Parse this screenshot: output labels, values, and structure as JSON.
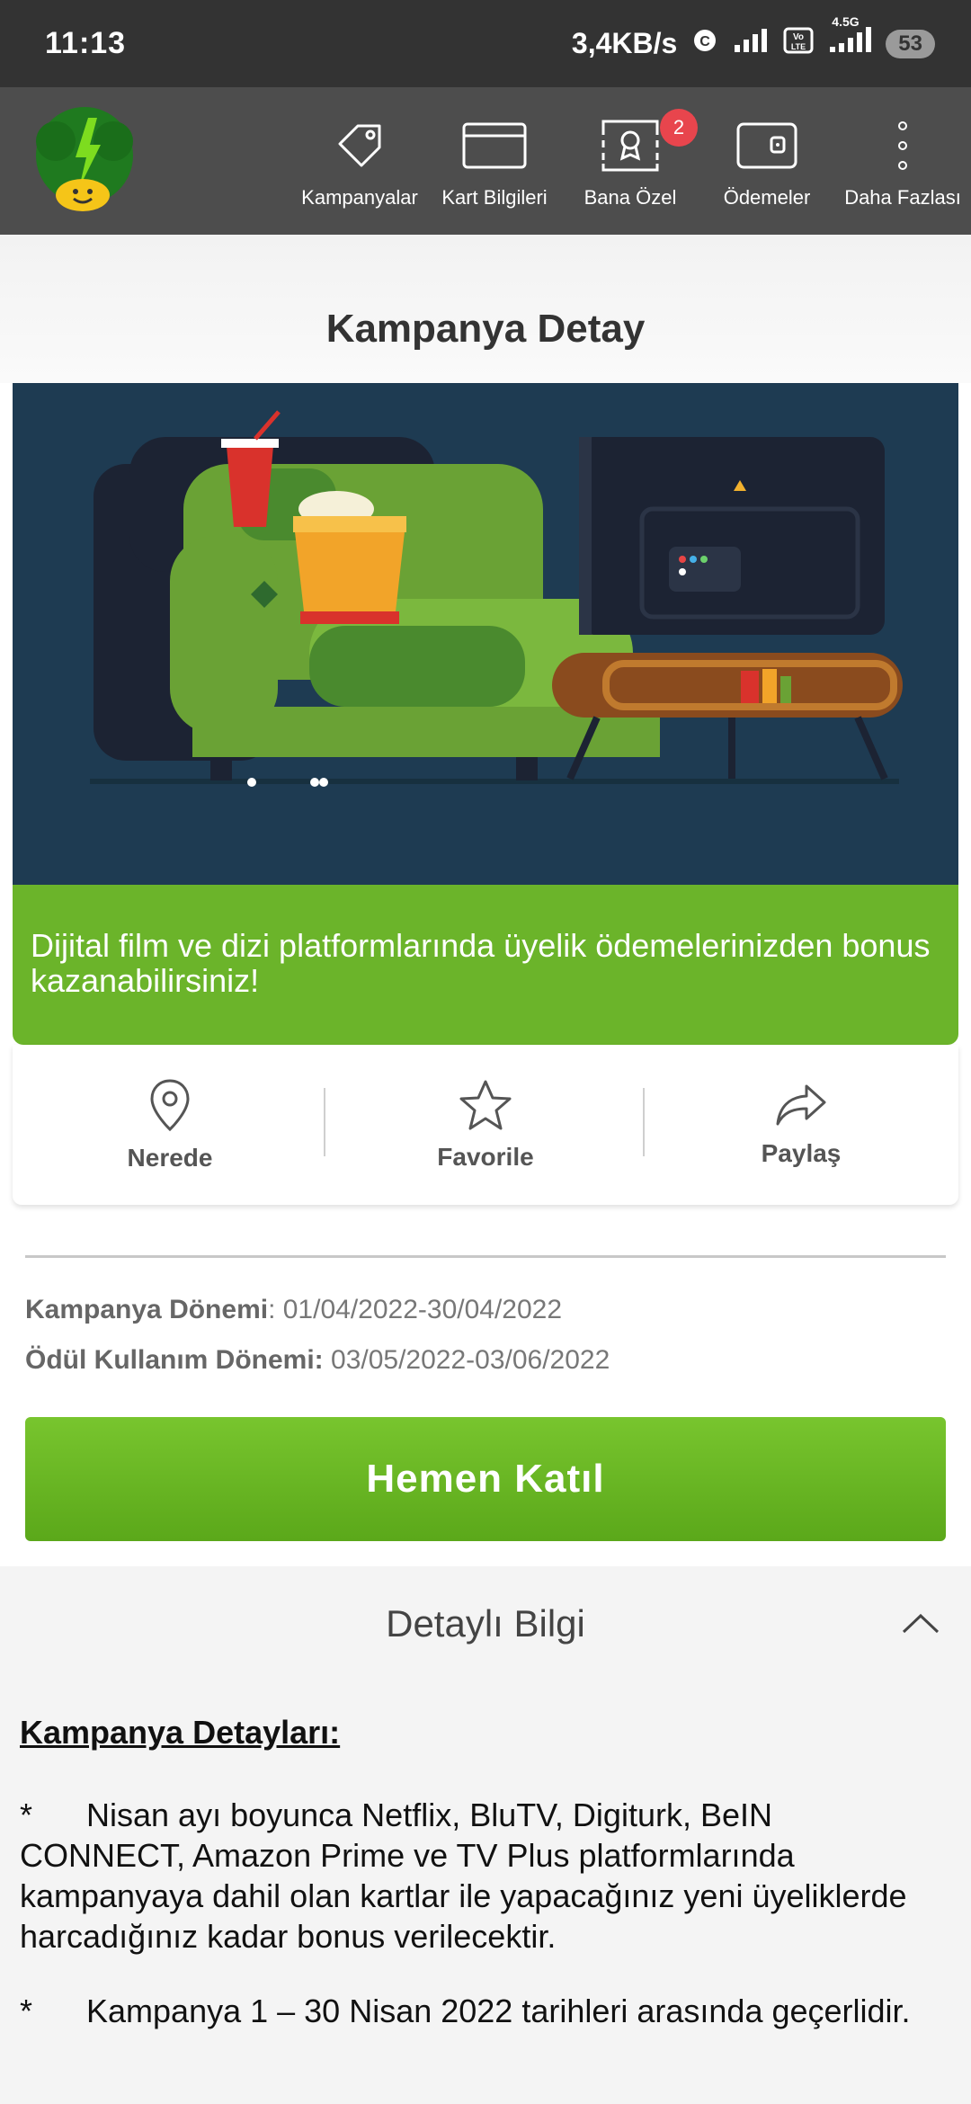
{
  "status_bar": {
    "time": "11:13",
    "speed": "3,4KB/s",
    "network_label": "4.5G",
    "volte_label": "Vo LTE",
    "battery": "53"
  },
  "nav": {
    "items": [
      {
        "label": "Kampanyalar",
        "icon": "tag-icon"
      },
      {
        "label": "Kart Bilgileri",
        "icon": "card-icon"
      },
      {
        "label": "Bana Özel",
        "icon": "award-icon",
        "badge": "2"
      },
      {
        "label": "Ödemeler",
        "icon": "wallet-icon"
      },
      {
        "label": "Daha Fazlası",
        "icon": "more-vertical-icon"
      }
    ]
  },
  "page": {
    "title": "Kampanya Detay"
  },
  "banner": {
    "caption": "Dijital film ve dizi platformlarında üyelik ödemelerinizden bonus kazanabilirsiniz!"
  },
  "actions": [
    {
      "label": "Nerede",
      "icon": "location-pin-icon"
    },
    {
      "label": "Favorile",
      "icon": "star-icon"
    },
    {
      "label": "Paylaş",
      "icon": "share-icon"
    }
  ],
  "periods": {
    "campaign_label": "Kampanya Dönemi",
    "campaign_value": ": 01/04/2022-30/04/2022",
    "reward_label": "Ödül Kullanım Dönemi:",
    "reward_value": " 03/05/2022-03/06/2022"
  },
  "cta": {
    "label": "Hemen Katıl"
  },
  "details": {
    "title": "Detaylı Bilgi",
    "heading": "Kampanya Detayları:",
    "bullets": [
      "Nisan ayı boyunca Netflix, BluTV, Digiturk, BeIN CONNECT, Amazon Prime ve TV Plus platformlarında kampanyaya dahil olan kartlar ile yapacağınız yeni üyeliklerde harcadığınız kadar bonus verilecektir.",
      "Kampanya 1 – 30 Nisan 2022 tarihleri arasında geçerlidir."
    ],
    "bullet_marker": "*"
  },
  "colors": {
    "brand_green": "#6bb42a",
    "nav_bg": "#4d4d4d",
    "banner_bg": "#1e3b52",
    "badge_red": "#e8454d"
  }
}
